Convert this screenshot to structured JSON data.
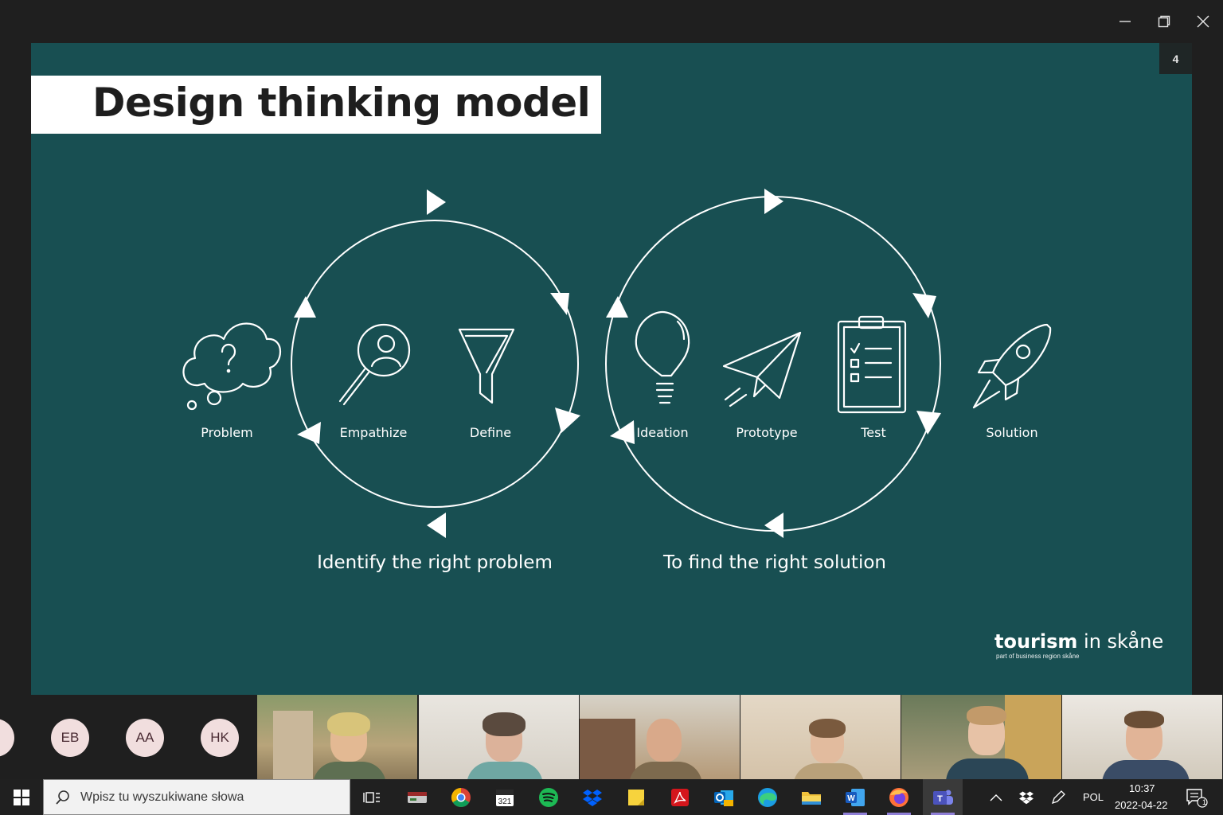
{
  "window": {
    "controls": [
      "minimize-icon",
      "restore-icon",
      "close-icon"
    ]
  },
  "slide": {
    "title": "Design thinking model",
    "page_number": "4",
    "steps": {
      "problem": "Problem",
      "empathize": "Empathize",
      "define": "Define",
      "ideation": "Ideation",
      "prototype": "Prototype",
      "test": "Test",
      "solution": "Solution"
    },
    "captions": {
      "left": "Identify the right problem",
      "right": "To find the right solution"
    },
    "brand": {
      "name_bold": "tourism",
      "name_regular": " in skåne",
      "tagline": "part of business region skåne"
    },
    "colors": {
      "background": "#184f52",
      "foreground": "#ffffff"
    }
  },
  "participants": {
    "avatars": [
      {
        "initials": "EB"
      },
      {
        "initials": "AA"
      },
      {
        "initials": "HK"
      }
    ],
    "video_tiles": 6
  },
  "taskbar": {
    "search_placeholder": "Wpisz tu wyszukiwane słowa",
    "apps": [
      "task-view-icon",
      "drive-icon",
      "chrome-icon",
      "calendar-icon",
      "spotify-icon",
      "dropbox-icon",
      "sticky-notes-icon",
      "acrobat-icon",
      "outlook-icon",
      "edge-icon",
      "file-explorer-icon",
      "word-icon",
      "firefox-icon",
      "teams-icon"
    ],
    "language": "POL",
    "time": "10:37",
    "date": "2022-04-22",
    "notification_count": "1"
  }
}
